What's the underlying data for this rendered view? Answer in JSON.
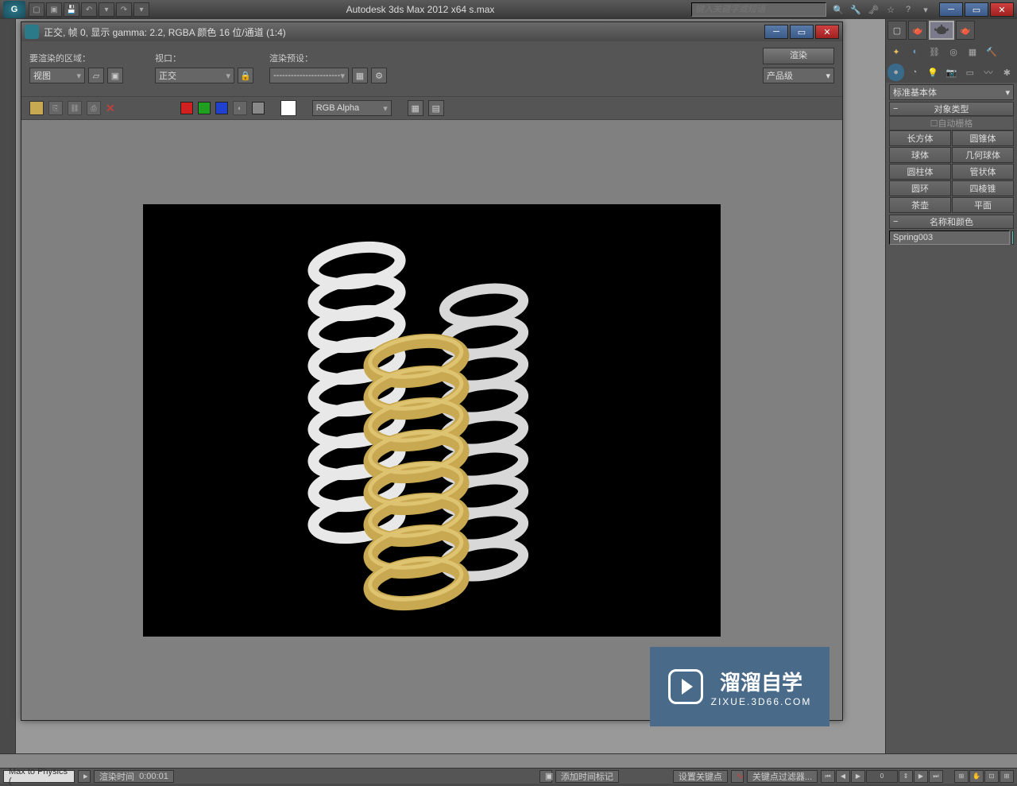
{
  "titlebar": {
    "app_title": "Autodesk 3ds Max  2012 x64     s.max",
    "search_placeholder": "键入关键字或短语"
  },
  "render_window": {
    "title": "正交, 帧 0, 显示 gamma: 2.2, RGBA 颜色 16 位/通道 (1:4)",
    "area_label": "要渲染的区域：",
    "area_value": "视图",
    "viewport_label": "视口：",
    "viewport_value": "正交",
    "preset_label": "渲染预设：",
    "preset_value": "-----------------------",
    "render_btn": "渲染",
    "mode_value": "产品级",
    "channel_value": "RGB Alpha"
  },
  "command_panel": {
    "dropdown": "标准基本体",
    "section_objtype": "对象类型",
    "auto_grid": "自动栅格",
    "primitives": [
      [
        "长方体",
        "圆锥体"
      ],
      [
        "球体",
        "几何球体"
      ],
      [
        "圆柱体",
        "管状体"
      ],
      [
        "圆环",
        "四棱锥"
      ],
      [
        "茶壶",
        "平面"
      ]
    ],
    "section_namecolor": "名称和颜色",
    "object_name": "Spring003"
  },
  "status": {
    "script": "Max to Physics (",
    "render_time_label": "渲染时间",
    "render_time": "0:00:01",
    "add_marker": "添加时间标记",
    "set_key": "设置关键点",
    "key_filter": "关键点过滤器...",
    "frame": "0"
  },
  "watermark": {
    "main": "溜溜自学",
    "sub": "ZIXUE.3D66.COM"
  }
}
